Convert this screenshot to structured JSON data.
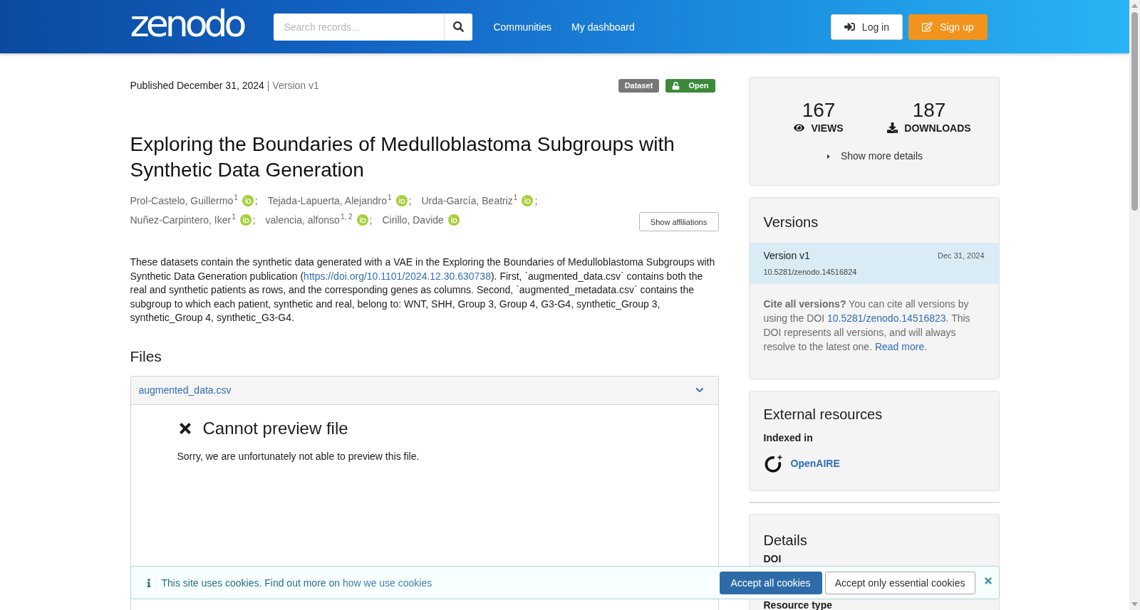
{
  "header": {
    "logo": "zenodo",
    "search": {
      "placeholder": "Search records..."
    },
    "nav": [
      {
        "label": "Communities"
      },
      {
        "label": "My dashboard"
      }
    ],
    "buttons": [
      {
        "label": "Log in",
        "kind": "login"
      },
      {
        "label": "Sign up",
        "kind": "signup"
      }
    ]
  },
  "record": {
    "published": "Published December 31, 2024",
    "version": "| Version v1",
    "badges": [
      {
        "label": "Dataset",
        "kind": "resource_type"
      },
      {
        "label": "Open",
        "kind": "access"
      }
    ],
    "title": "Exploring the Boundaries of Medulloblastoma Subgroups with Synthetic Data Generation",
    "authors": [
      {
        "name": "Prol-Castelo, Guillermo",
        "affiliations": "1",
        "orcid": true,
        "separator": ";"
      },
      {
        "name": "Tejada-Lapuerta, Alejandro",
        "affiliations": "1",
        "orcid": true,
        "separator": ";"
      },
      {
        "name": "Urda-García, Beatriz",
        "affiliations": "1",
        "orcid": true,
        "separator": ";"
      },
      {
        "name": "Nuñez-Carpintero, Iker",
        "affiliations": "1",
        "orcid": true,
        "separator": ";"
      },
      {
        "name": "valencia, alfonso",
        "affiliations": "1, 2",
        "orcid": true,
        "separator": ";"
      },
      {
        "name": "Cirillo, Davide",
        "orcid": true
      }
    ],
    "show_affiliations": "Show affiliations",
    "description": [
      {
        "kind": "text",
        "text": "These datasets contain the synthetic data generated with a VAE in the Exploring the Boundaries of Medulloblastoma Subgroups with Synthetic Data Generation publication ("
      },
      {
        "kind": "link",
        "text": "https://doi.org/10.1101/2024.12.30.630738"
      },
      {
        "kind": "text",
        "text": "). First, `augmented_data.csv` contains both the real and synthetic patients as rows, and the corresponding genes as columns. Second, `augmented_metadata.csv` contains the subgroup to which each patient, synthetic and real, belong to: WNT, SHH, Group 3, Group 4, G3-G4, synthetic_Group 3, synthetic_Group 4, synthetic_G3-G4."
      }
    ]
  },
  "files": {
    "heading": "Files",
    "items": [
      {
        "name": "augmented_data.csv",
        "expanded": true,
        "preview_title": "Cannot preview file",
        "preview_message": "Sorry, we are unfortunately not able to preview this file."
      }
    ]
  },
  "sidebar": {
    "stats": [
      {
        "value": "167",
        "label": "VIEWS",
        "kind": "views"
      },
      {
        "value": "187",
        "label": "DOWNLOADS",
        "kind": "downloads"
      }
    ],
    "more_details": {
      "label": "Show more details",
      "expanded": false
    },
    "versions": {
      "heading": "Versions",
      "items": [
        {
          "label": "Version v1",
          "date": "Dec 31, 2024",
          "doi": "10.5281/zenodo.14516824",
          "selected": true
        }
      ],
      "cite": [
        {
          "kind": "text",
          "text": "**Cite all versions?** You can cite all versions by using the DOI "
        },
        {
          "kind": "link",
          "text": "10.5281/zenodo.14516823"
        },
        {
          "kind": "text",
          "text": ". This DOI represents all versions, and will always resolve to the latest one. "
        },
        {
          "kind": "link",
          "text": "Read more."
        }
      ]
    },
    "external_resources": {
      "heading": "External resources",
      "subheading": "Indexed in",
      "items": [
        {
          "name": "OpenAIRE"
        }
      ]
    },
    "details": {
      "heading": "Details",
      "fields": [
        {
          "label": "DOI"
        },
        {
          "label": "Resource type"
        }
      ]
    }
  },
  "cookie_banner": {
    "message": [
      {
        "kind": "text",
        "text": "This site uses cookies. Find out more on "
      },
      {
        "kind": "link",
        "text": "how we use cookies"
      }
    ],
    "buttons": [
      {
        "label": "Accept all cookies",
        "kind": "primary"
      },
      {
        "label": "Accept only essential cookies",
        "kind": "secondary"
      }
    ]
  }
}
